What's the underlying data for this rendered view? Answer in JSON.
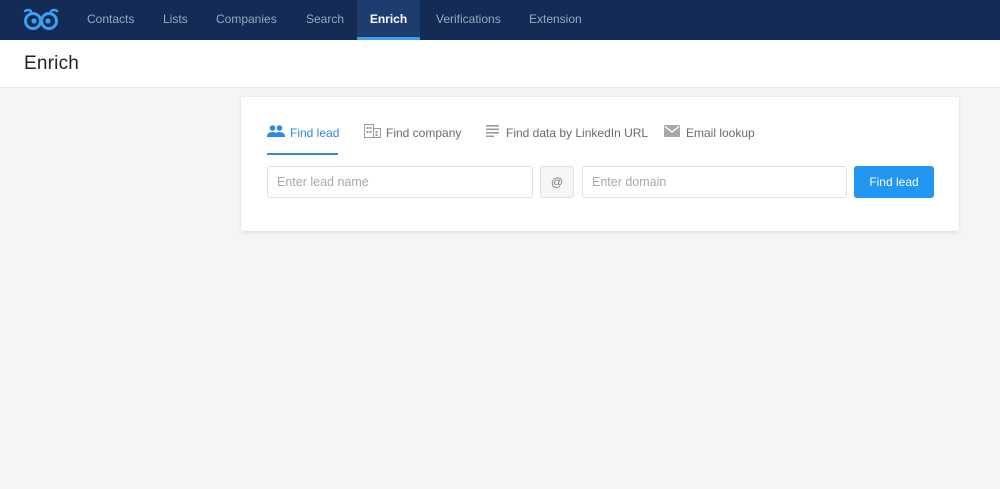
{
  "nav": {
    "items": [
      {
        "label": "Contacts"
      },
      {
        "label": "Lists"
      },
      {
        "label": "Companies"
      },
      {
        "label": "Search"
      },
      {
        "label": "Enrich",
        "active": true
      },
      {
        "label": "Verifications"
      },
      {
        "label": "Extension"
      }
    ]
  },
  "page": {
    "title": "Enrich"
  },
  "tabs": [
    {
      "label": "Find lead",
      "icon": "people-icon",
      "active": true
    },
    {
      "label": "Find company",
      "icon": "building-icon"
    },
    {
      "label": "Find data by LinkedIn URL",
      "icon": "lines-icon"
    },
    {
      "label": "Email lookup",
      "icon": "envelope-icon"
    }
  ],
  "form": {
    "lead_placeholder": "Enter lead name",
    "at_symbol": "@",
    "domain_placeholder": "Enter domain",
    "submit_label": "Find lead"
  },
  "colors": {
    "nav_bg": "#132b55",
    "accent": "#2196f3",
    "page_bg": "#f5f5f5"
  }
}
